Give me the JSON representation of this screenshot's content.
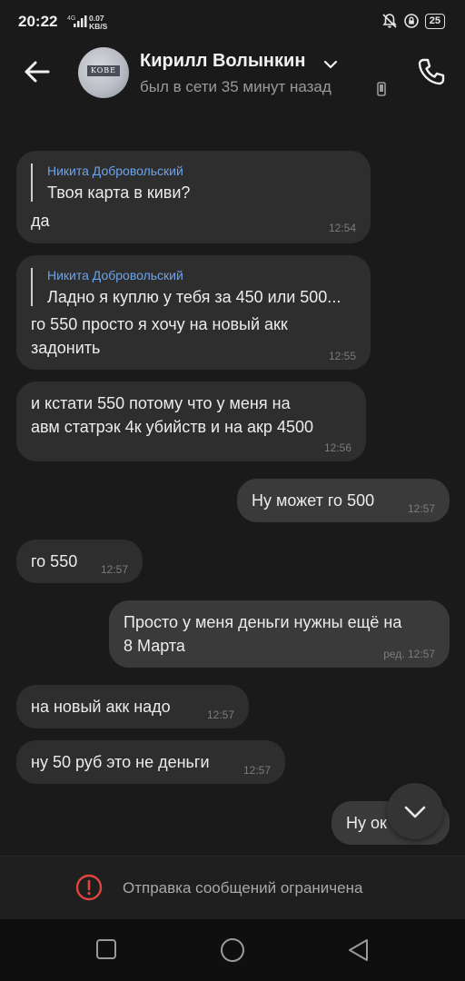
{
  "status_bar": {
    "time": "20:22",
    "network_type": "4G",
    "speed_value": "0.07",
    "speed_unit": "KB/S",
    "battery": "25"
  },
  "header": {
    "contact_name": "Кирилл Волынкин",
    "last_seen": "был в сети 35 минут назад",
    "avatar_badge": "KOBE"
  },
  "messages": [
    {
      "direction": "in",
      "reply_name": "Никита Добровольский",
      "reply_text": "Твоя карта в киви?",
      "lines": [
        "да"
      ],
      "time": "12:54"
    },
    {
      "direction": "in",
      "reply_name": "Никита Добровольский",
      "reply_text": "Ладно я куплю у тебя за 450 или 500...",
      "lines": [
        "го 550 просто я хочу на новый акк",
        "задонить"
      ],
      "time": "12:55"
    },
    {
      "direction": "in",
      "lines": [
        "и кстати 550 потому что у меня на",
        "авм статрэк 4к убийств и на акр 4500"
      ],
      "time": "12:56"
    },
    {
      "direction": "out",
      "lines": [
        "Ну может го 500"
      ],
      "time": "12:57"
    },
    {
      "direction": "in",
      "lines": [
        "го 550"
      ],
      "time": "12:57"
    },
    {
      "direction": "out",
      "lines": [
        "Просто у меня деньги нужны ещё на",
        "8 Марта"
      ],
      "edited": "ред.",
      "time": "12:57"
    },
    {
      "direction": "in",
      "lines": [
        "на новый акк надо"
      ],
      "time": "12:57"
    },
    {
      "direction": "in",
      "lines": [
        "ну 50 руб это не деньги"
      ],
      "time": "12:57"
    },
    {
      "direction": "out",
      "lines": [
        "Ну ок"
      ]
    }
  ],
  "restriction": {
    "text": "Отправка сообщений ограничена"
  },
  "colors": {
    "background": "#1a1a1a",
    "bubble_in": "#2e2e2e",
    "bubble_out": "#3a3a3a",
    "reply_name": "#6da3ea",
    "warning": "#e0453f"
  }
}
